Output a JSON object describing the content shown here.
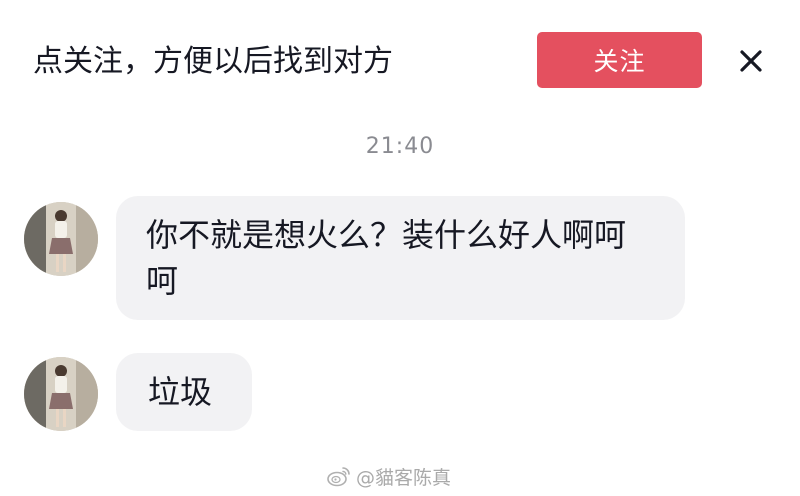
{
  "follow_banner": {
    "prompt": "点关注，方便以后找到对方",
    "follow_label": "关注",
    "close_icon": "close-icon",
    "accent_color": "#e4505f"
  },
  "timestamp": "21:40",
  "messages": [
    {
      "sender": "other",
      "text": "你不就是想火么？装什么好人啊呵呵"
    },
    {
      "sender": "other",
      "text": "垃圾"
    }
  ],
  "watermark": {
    "icon": "weibo-icon",
    "text": "@貓客陈真"
  }
}
